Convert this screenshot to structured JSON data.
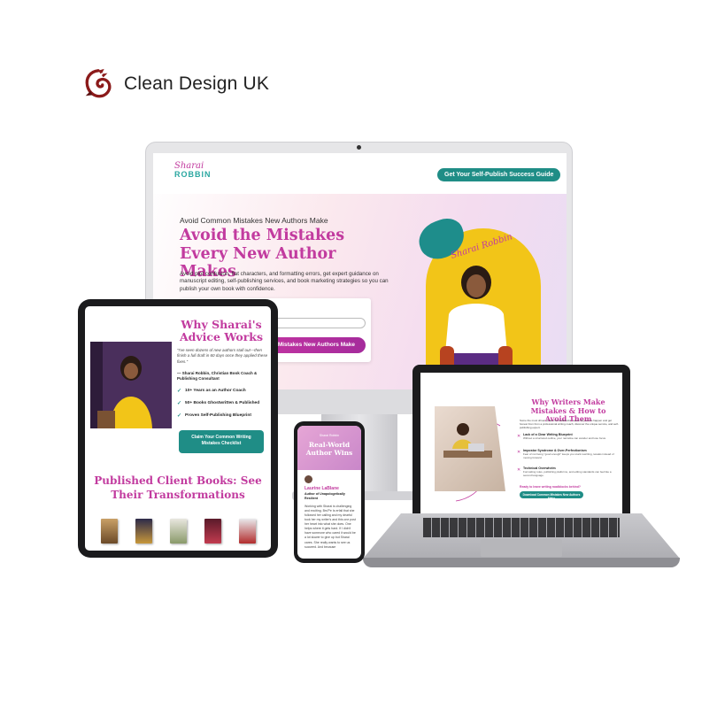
{
  "brand": {
    "name": "Clean Design UK",
    "logo_icon": "dragon-logo-icon",
    "accent": "#8b1a1a"
  },
  "colors": {
    "magenta": "#c23b9f",
    "teal": "#1f8d86",
    "yellow": "#f2c518"
  },
  "desktop": {
    "logo_line1": "Sharai",
    "logo_line2": "ROBBIN",
    "nav_cta": "Get Your Self-Publish Success Guide",
    "kicker": "Avoid Common Mistakes New Authors Make",
    "title": "Avoid the Mistakes Every New Author Makes",
    "description": "Avoid plot confusion, flat characters, and formatting errors, get expert guidance on manuscript editing, self-publishing services, and book marketing strategies so you can publish your own book with confidence.",
    "submit_label": "Mistakes New Authors Make",
    "signature": "Sharai Robbin"
  },
  "tablet": {
    "heading": "Why Sharai's Advice Works",
    "quote": "\"I've seen dozens of new authors stall out—then finish a full draft in 60 days once they applied these fixes.\"",
    "attribution": "— Sharai Robbin, Christian Book Coach & Publishing Consultant",
    "bullets": [
      "10+ Years as an Author Coach",
      "50+ Books Ghostwritten & Published",
      "Proven Self-Publishing Blueprint"
    ],
    "cta": "Claim Your Common Writing Mistakes Checklist",
    "books_title": "Published Client Books: See Their Transformations"
  },
  "phone": {
    "brand": "Sharai Robbin",
    "heading": "Real-World Author Wins",
    "name": "Laurine LaBlane",
    "role": "Author of Unapologetically Resilient",
    "body": "Working with Sharai is challenging and exciting. Brs'Pe Is erfall that she followed her calling and my dearful took her my writer's and this one post her heart into what she does. One helps where it gets hard. If I didn't have someone who cared it would be a lot slower to give up but Sharai cares. She really wants to see us succeed. And because"
  },
  "laptop": {
    "heading": "Why Writers Make Mistakes & How to Avoid Them",
    "intro": "Some the most driven writers hit roadblocks. Learn why errors happen and get honest from from a professional writing coach, discover the unique service, and self-publishing expert.",
    "items": [
      {
        "title": "Lack of a Clear Writing Blueprint",
        "desc": "Without a structured outline, your narrative can wander and lose focus."
      },
      {
        "title": "Impostor Syndrome & Over-Perfectionism",
        "desc": "Fear of not being \"good enough\" keeps you stuck rewriting, tweaks instead of moving forward."
      },
      {
        "title": "Technical Overwhelm",
        "desc": "Formatting rules, publishing platforms, and editing standards can feel like a second language."
      }
    ],
    "ready": "Ready to leave writing roadblocks behind?",
    "button": "Download Common Mistakes New Authors Make"
  }
}
